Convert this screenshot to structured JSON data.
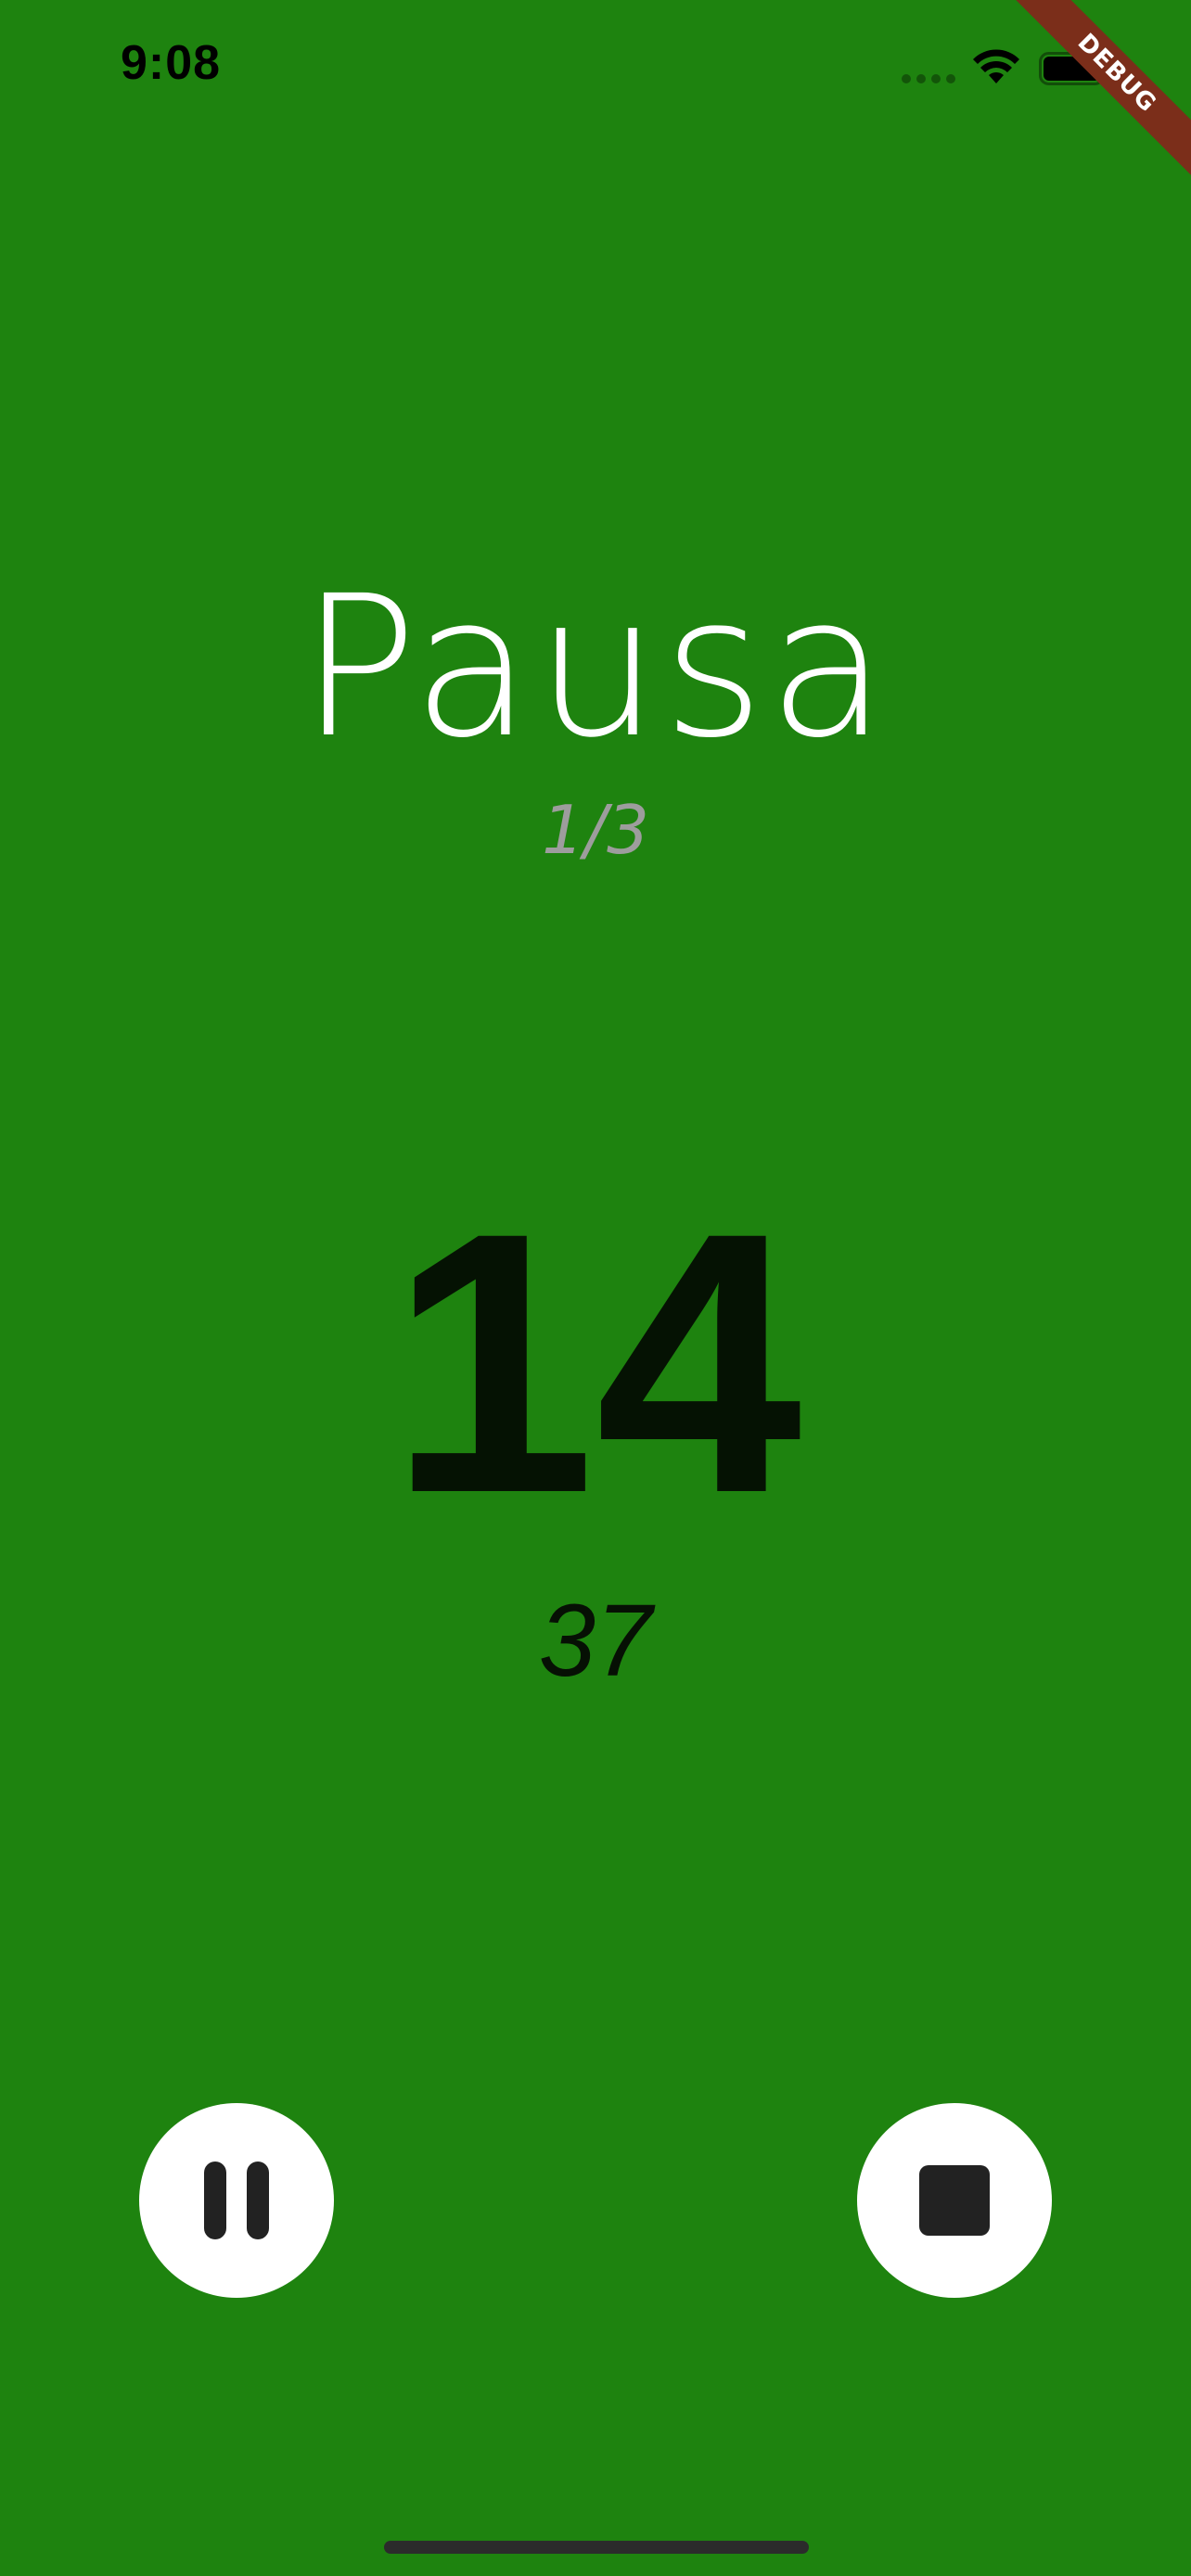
{
  "status_bar": {
    "time": "9:08"
  },
  "debug_banner": {
    "label": "DEBUG"
  },
  "timer": {
    "phase": "Pausa",
    "round": "1/3",
    "countdown": "14",
    "total": "37"
  },
  "controls": {
    "pause_icon": "pause-icon",
    "stop_icon": "stop-icon"
  },
  "colors": {
    "background": "#1e830f",
    "button": "#ffffff",
    "icon": "#222222",
    "debug_ribbon": "#7b2e1a"
  }
}
